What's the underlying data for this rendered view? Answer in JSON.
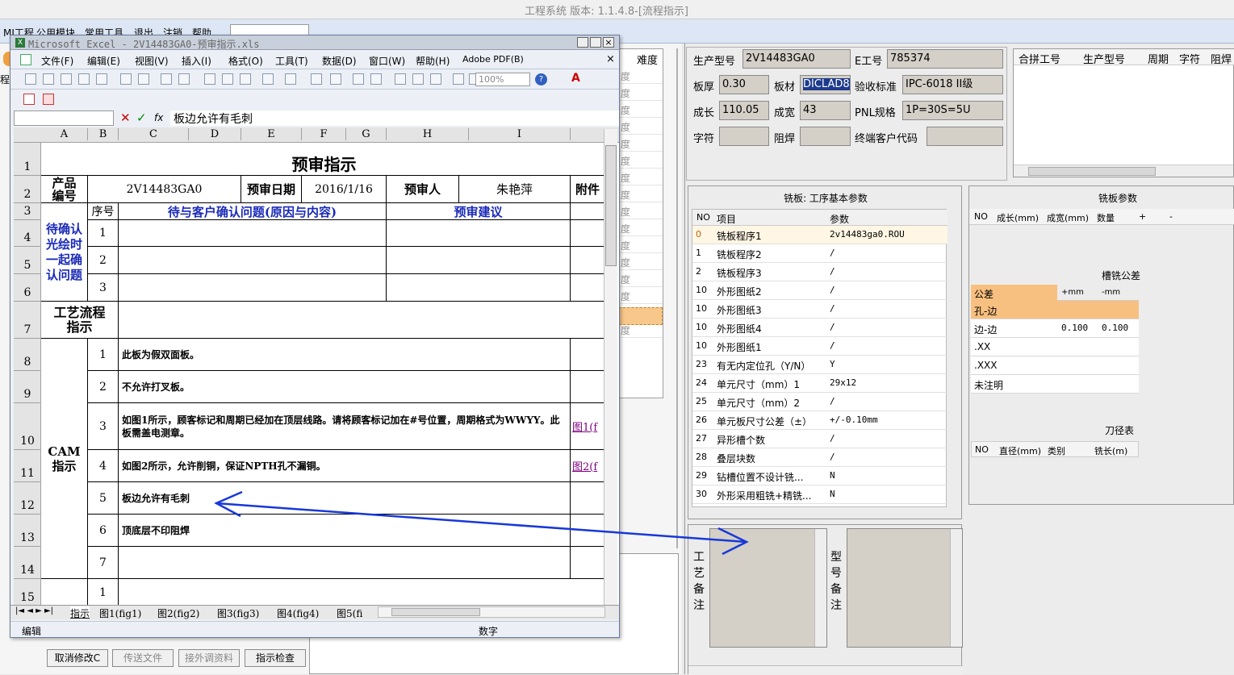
{
  "app": {
    "title": "工程系统 版本: 1.1.4.8-[流程指示]"
  },
  "main_menu": [
    "MI工程",
    "公用模块",
    "常用工具",
    "退出",
    "注销",
    "帮助"
  ],
  "left_grid": {
    "header": "难度",
    "row_chars": [
      "度",
      "度",
      "度",
      "度",
      "度",
      "度",
      "度",
      "度",
      "度",
      "度",
      "度",
      "度",
      "度",
      "度",
      "度",
      "度"
    ]
  },
  "bottom_buttons": [
    "取消修改C",
    "传送文件",
    "接外调资料",
    "指示检查"
  ],
  "info": {
    "model_label": "生产型号",
    "model": "2V14483GA0",
    "e_label": "E工号",
    "e_no": "785374",
    "thick_label": "板厚",
    "thick": "0.30",
    "mat_label": "板材",
    "mat": "DICLAD8",
    "std_label": "验收标准",
    "std": "IPC-6018 II级",
    "len_label": "成长",
    "len": "110.05",
    "wid_label": "成宽",
    "wid": "43",
    "pnl_label": "PNL规格",
    "pnl": "1P=30S=5U",
    "char_label": "字符",
    "char": "",
    "mask_label": "阻焊",
    "mask": "",
    "cust_label": "终端客户代码",
    "cust": ""
  },
  "combine_table": {
    "headers": [
      "合拼工号",
      "生产型号",
      "周期",
      "字符",
      "阻焊"
    ]
  },
  "mill_basic": {
    "title": "铣板: 工序基本参数",
    "headers": [
      "NO",
      "项目",
      "参数"
    ],
    "rows": [
      {
        "no": "0",
        "item": "铣板程序1",
        "val": "2v14483ga0.ROU"
      },
      {
        "no": "1",
        "item": "铣板程序2",
        "val": "/"
      },
      {
        "no": "2",
        "item": "铣板程序3",
        "val": "/"
      },
      {
        "no": "10",
        "item": "外形图纸2",
        "val": "/"
      },
      {
        "no": "10",
        "item": "外形图纸3",
        "val": "/"
      },
      {
        "no": "10",
        "item": "外形图纸4",
        "val": "/"
      },
      {
        "no": "10",
        "item": "外形图纸1",
        "val": "/"
      },
      {
        "no": "23",
        "item": "有无内定位孔（Y/N）",
        "val": "Y"
      },
      {
        "no": "24",
        "item": "单元尺寸（mm）1",
        "val": "29x12"
      },
      {
        "no": "25",
        "item": "单元尺寸（mm）2",
        "val": "/"
      },
      {
        "no": "26",
        "item": "单元板尺寸公差（±）",
        "val": "+/-0.10mm"
      },
      {
        "no": "27",
        "item": "异形槽个数",
        "val": "/"
      },
      {
        "no": "28",
        "item": "叠层块数",
        "val": "/"
      },
      {
        "no": "29",
        "item": "钻槽位置不设计铣...",
        "val": "N"
      },
      {
        "no": "30",
        "item": "外形采用粗铣+精铣...",
        "val": "N"
      }
    ]
  },
  "mill_params": {
    "title": "铣板参数",
    "headers": [
      "NO",
      "成长(mm)",
      "成宽(mm)",
      "数量",
      "+",
      "-"
    ]
  },
  "slot_tol": {
    "title": "槽铣公差",
    "headers": [
      "公差",
      "+mm",
      "-mm"
    ],
    "rows": [
      {
        "a": "孔-边",
        "b": "",
        "c": ""
      },
      {
        "a": "边-边",
        "b": "0.100",
        "c": "0.100"
      },
      {
        "a": ".XX",
        "b": "",
        "c": ""
      },
      {
        "a": ".XXX",
        "b": "",
        "c": ""
      },
      {
        "a": "未注明",
        "b": "",
        "c": ""
      }
    ]
  },
  "tool_table": {
    "title": "刀径表",
    "headers": [
      "NO",
      "直径(mm)",
      "类别",
      "铣长(m)"
    ]
  },
  "notes": {
    "proc_label": "工艺备注",
    "model_label": "型号备注"
  },
  "excel": {
    "title": "Microsoft Excel - 2V14483GA0-预审指示.xls",
    "menu": [
      "文件(F)",
      "编辑(E)",
      "视图(V)",
      "插入(I)",
      "格式(O)",
      "工具(T)",
      "数据(D)",
      "窗口(W)",
      "帮助(H)",
      "Adobe PDF(B)"
    ],
    "zoom": "100%",
    "formula": "板边允许有毛刺",
    "col_headers": [
      "A",
      "B",
      "C",
      "D",
      "E",
      "F",
      "G",
      "H",
      "I"
    ],
    "row_numbers": [
      "1",
      "2",
      "3",
      "4",
      "5",
      "6",
      "7",
      "8",
      "9",
      "10",
      "11",
      "12",
      "13",
      "14",
      "15"
    ],
    "sheet_title": "预审指示",
    "product_label": "产品编号",
    "product": "2V14483GA0",
    "date_label": "预审日期",
    "date": "2016/1/16",
    "person_label": "预审人",
    "person": "朱艳萍",
    "attach_label": "附件",
    "seq_label": "序号",
    "question_label": "待与客户确认问题(原因与内容)",
    "advice_label": "预审建议",
    "confirm_label": "待确认光绘时一起确认问题",
    "nums": [
      "1",
      "2",
      "3"
    ],
    "flow_label": "工艺流程指示",
    "cam_label": "CAM指示",
    "cam_items": [
      {
        "n": "1",
        "t": "此板为假双面板。",
        "link": ""
      },
      {
        "n": "2",
        "t": "不允许打叉板。",
        "link": ""
      },
      {
        "n": "3",
        "t": "如图1所示，顾客标记和周期已经加在顶层线路。请将顾客标记加在#号位置，周期格式为WWYY。此板需盖电测章。",
        "link": "图1(f"
      },
      {
        "n": "4",
        "t": "如图2所示，允许削铜，保证NPTH孔不漏铜。",
        "link": "图2(f"
      },
      {
        "n": "5",
        "t": "板边允许有毛刺",
        "link": ""
      },
      {
        "n": "6",
        "t": "顶底层不印阻焊",
        "link": ""
      },
      {
        "n": "7",
        "t": "",
        "link": ""
      }
    ],
    "row15_num": "1",
    "tabs": [
      "指示",
      "图1(fig1)",
      "图2(fig2)",
      "图3(fig3)",
      "图4(fig4)",
      "图5(fi"
    ],
    "status_left": "编辑",
    "status_right": "数字"
  }
}
